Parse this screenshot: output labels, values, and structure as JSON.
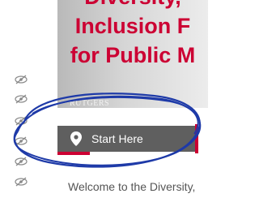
{
  "banner": {
    "lines": [
      "Diversity,",
      "Inclusion F",
      "for Public M"
    ],
    "logo": "RUTGERS"
  },
  "nav": {
    "start_here": "Start Here"
  },
  "content": {
    "welcome": "Welcome to the Diversity,"
  },
  "colors": {
    "brand_red": "#cc0033",
    "bar_gray": "#5f5f5f",
    "ink_blue": "#1e3aa8"
  },
  "icons": {
    "hidden": "eye-slash-icon",
    "location": "map-pin-icon"
  }
}
